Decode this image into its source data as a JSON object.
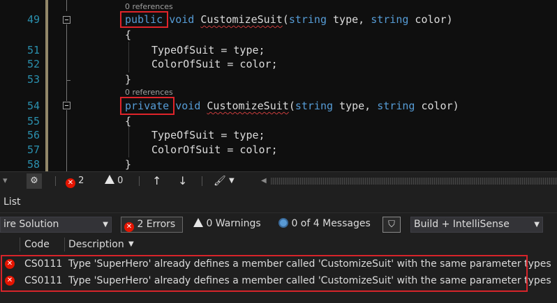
{
  "editor": {
    "line_numbers": [
      "49",
      "51",
      "52",
      "53",
      "54",
      "55",
      "56",
      "57",
      "58"
    ],
    "codelens": [
      "0 references",
      "0 references"
    ],
    "method1": {
      "modifier": "public",
      "rest_kw1": "void",
      "name": "CustomizeSuit",
      "paren_open": "(",
      "type1": "string",
      "param1": " type, ",
      "type2": "string",
      "param2": " color)"
    },
    "method2": {
      "modifier": "private",
      "rest_kw1": "void",
      "name": "CustomizeSuit",
      "paren_open": "(",
      "type1": "string",
      "param1": " type, ",
      "type2": "string",
      "param2": " color)"
    },
    "brace_open": "{",
    "brace_close": "}",
    "body_line1": "TypeOfSuit = type;",
    "body_line2": "ColorOfSuit = color;",
    "body_line3": "TypeOfSuit = type;",
    "body_line4": "ColorOfSuit = color;"
  },
  "status_strip": {
    "error_count": "2",
    "warning_count": "0",
    "up_arrow": "↑",
    "down_arrow": "↓"
  },
  "panel": {
    "title": "List",
    "scope_dropdown": "ire Solution",
    "errors_btn": "2 Errors",
    "warnings_btn": "0 Warnings",
    "messages_btn": "0 of 4 Messages",
    "build_dropdown": "Build + IntelliSense",
    "columns": {
      "code": "Code",
      "description": "Description"
    },
    "rows": [
      {
        "code": "CS0111",
        "description": "Type 'SuperHero' already defines a member called 'CustomizeSuit' with the same parameter types"
      },
      {
        "code": "CS0111",
        "description": "Type 'SuperHero' already defines a member called 'CustomizeSuit' with the same parameter types"
      }
    ]
  }
}
